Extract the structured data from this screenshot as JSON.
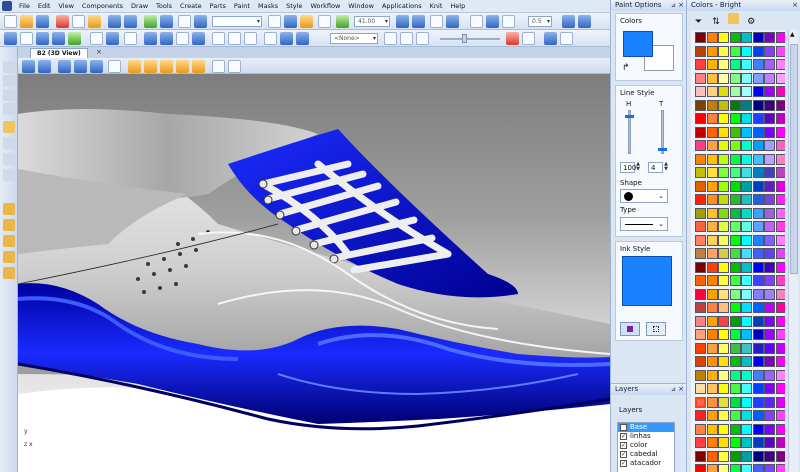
{
  "menu": [
    "File",
    "Edit",
    "View",
    "Components",
    "Draw",
    "Tools",
    "Create",
    "Parts",
    "Paint",
    "Masks",
    "Style",
    "Workflow",
    "Window",
    "Applications",
    "Knit",
    "Help"
  ],
  "toolbar": {
    "zoom_value": "41.00",
    "opacity_value": "0.5",
    "style_combo": "<None>"
  },
  "document_tab": {
    "label": "B2 (3D View)",
    "close": "×"
  },
  "viewport": {
    "axis_y": "y",
    "axis_zx": "z   x"
  },
  "paint_options": {
    "title": "Paint Options",
    "colors_label": "Colors",
    "fg_color": "#1a82ff",
    "bg_color": "#ffffff",
    "line_style_label": "Line Style",
    "h_label": "H",
    "t_label": "T",
    "h_value": "100",
    "t_value": "4",
    "h_level": 0.9,
    "t_level": 0.1,
    "shape_label": "Shape",
    "type_label": "Type",
    "ink_style_label": "Ink Style",
    "ink_color": "#1a82ff"
  },
  "layers": {
    "title": "Layers",
    "heading": "Layers",
    "items": [
      {
        "name": "Base",
        "checked": false,
        "selected": true
      },
      {
        "name": "linhas",
        "checked": true,
        "selected": false
      },
      {
        "name": "color",
        "checked": true,
        "selected": false
      },
      {
        "name": "cabedal",
        "checked": true,
        "selected": false
      },
      {
        "name": "atacador",
        "checked": true,
        "selected": false
      }
    ]
  },
  "colors_panel": {
    "title": "Colors - Bright",
    "palette": [
      [
        "#800000",
        "#ff8000",
        "#ffff00",
        "#00c000",
        "#00c0c0",
        "#0000c0",
        "#8000c0",
        "#ff00ff"
      ],
      [
        "#c04000",
        "#ff9900",
        "#ffff40",
        "#40ff40",
        "#00ffff",
        "#0040ff",
        "#8040ff",
        "#ff40ff"
      ],
      [
        "#ff4040",
        "#ffb000",
        "#ffff80",
        "#00ff80",
        "#40ffff",
        "#4080ff",
        "#a060ff",
        "#ff80ff"
      ],
      [
        "#ff8080",
        "#ffc040",
        "#ffffa0",
        "#80ff80",
        "#80ffff",
        "#80a0ff",
        "#c080ff",
        "#ffa0ff"
      ],
      [
        "#ffc0c0",
        "#ffd080",
        "#e0e000",
        "#a0ffa0",
        "#a0ffff",
        "#0000ff",
        "#a000ff",
        "#ff00c0"
      ],
      [
        "#804000",
        "#c08000",
        "#c0c000",
        "#008000",
        "#008080",
        "#000080",
        "#400080",
        "#800080"
      ],
      [
        "#ff0000",
        "#ff8040",
        "#ffff00",
        "#00ff00",
        "#00e0e0",
        "#2040ff",
        "#6000c0",
        "#c000c0"
      ],
      [
        "#c00000",
        "#ff6000",
        "#ffe000",
        "#40c000",
        "#00c0ff",
        "#0060ff",
        "#8000ff",
        "#ff00ff"
      ],
      [
        "#ff4080",
        "#ffa040",
        "#e0ff00",
        "#80ff00",
        "#00ffc0",
        "#00a0ff",
        "#a0a0ff",
        "#ff60c0"
      ],
      [
        "#ff8000",
        "#ffc000",
        "#c0ff00",
        "#00ff40",
        "#00ffe0",
        "#40c0ff",
        "#c0a0ff",
        "#ff80c0"
      ],
      [
        "#c0c000",
        "#ffe040",
        "#80ff40",
        "#40ff80",
        "#40e0e0",
        "#0080c0",
        "#4040c0",
        "#c040c0"
      ],
      [
        "#e06000",
        "#ffa000",
        "#a0ff00",
        "#00e000",
        "#00a0a0",
        "#0040c0",
        "#6020c0",
        "#e000e0"
      ],
      [
        "#ff2000",
        "#ff9020",
        "#c0e000",
        "#20c020",
        "#20c0c0",
        "#2060e0",
        "#8040e0",
        "#ff20ff"
      ],
      [
        "#a0a000",
        "#ffc020",
        "#80e000",
        "#00c040",
        "#00e0c0",
        "#40a0ff",
        "#a060e0",
        "#ff60ff"
      ],
      [
        "#ff6040",
        "#ffb040",
        "#e0ff40",
        "#60ff60",
        "#60ffe0",
        "#60a0ff",
        "#c060ff",
        "#ff40e0"
      ],
      [
        "#ff8060",
        "#ffd060",
        "#f0ff60",
        "#00ff00",
        "#00ffff",
        "#2080ff",
        "#8060ff",
        "#ff80ff"
      ],
      [
        "#c08040",
        "#ffa060",
        "#d0d040",
        "#40e040",
        "#40e0ff",
        "#4060ff",
        "#6040ff",
        "#e040ff"
      ],
      [
        "#800000",
        "#ff4000",
        "#ffff00",
        "#00c000",
        "#00c0c0",
        "#0000ff",
        "#4000c0",
        "#ff00ff"
      ],
      [
        "#ff6000",
        "#ff8000",
        "#ffff40",
        "#40ff40",
        "#40ffff",
        "#4040ff",
        "#8040ff",
        "#ff40c0"
      ],
      [
        "#ff0040",
        "#ffa000",
        "#ffe080",
        "#80ff80",
        "#80ffff",
        "#8080ff",
        "#a080ff",
        "#ff80c0"
      ],
      [
        "#c04040",
        "#ff8040",
        "#ffc080",
        "#00ff00",
        "#00e0ff",
        "#0060ff",
        "#c000ff",
        "#ff00a0"
      ],
      [
        "#ff8080",
        "#ffa000",
        "#ff4040",
        "#00a000",
        "#00ffff",
        "#0040c0",
        "#8000ff",
        "#ff00ff"
      ],
      [
        "#ffa080",
        "#ff8000",
        "#ffff00",
        "#00ff40",
        "#00c0ff",
        "#0000c0",
        "#a000ff",
        "#ff40ff"
      ],
      [
        "#ff4000",
        "#ffa040",
        "#ffff60",
        "#40c040",
        "#40c0c0",
        "#2020c0",
        "#6000ff",
        "#c000ff"
      ],
      [
        "#e04000",
        "#ff9000",
        "#ffe000",
        "#00c000",
        "#00c0c0",
        "#0000ff",
        "#8000c0",
        "#ff00ff"
      ],
      [
        "#c08000",
        "#ffb000",
        "#ffff80",
        "#00ff80",
        "#00ffc0",
        "#4080ff",
        "#a060ff",
        "#ff80ff"
      ],
      [
        "#ffe0a0",
        "#ffc060",
        "#ffff00",
        "#40ff40",
        "#40ffff",
        "#0040ff",
        "#8000ff",
        "#ff00ff"
      ],
      [
        "#ff6060",
        "#ff9040",
        "#e0e040",
        "#00e040",
        "#00ffff",
        "#2040ff",
        "#6020ff",
        "#e000ff"
      ],
      [
        "#ff2020",
        "#ffa000",
        "#ffff40",
        "#40ff40",
        "#00e0e0",
        "#0060ff",
        "#8040ff",
        "#ff40ff"
      ],
      [
        "#ff8040",
        "#ffc000",
        "#ffff00",
        "#00c000",
        "#00ffff",
        "#0000ff",
        "#8000ff",
        "#ff00ff"
      ],
      [
        "#ff4040",
        "#ff8000",
        "#ffe000",
        "#00ff00",
        "#00c0c0",
        "#0040c0",
        "#6000c0",
        "#c000c0"
      ],
      [
        "#800000",
        "#ff6000",
        "#ffff40",
        "#00a000",
        "#00a0a0",
        "#000080",
        "#400080",
        "#800080"
      ],
      [
        "#ff0000",
        "#ffa040",
        "#ffff80",
        "#00ff40",
        "#40ffff",
        "#4060ff",
        "#8040ff",
        "#ff40ff"
      ]
    ],
    "selected_cell": [
      27,
      0
    ]
  }
}
